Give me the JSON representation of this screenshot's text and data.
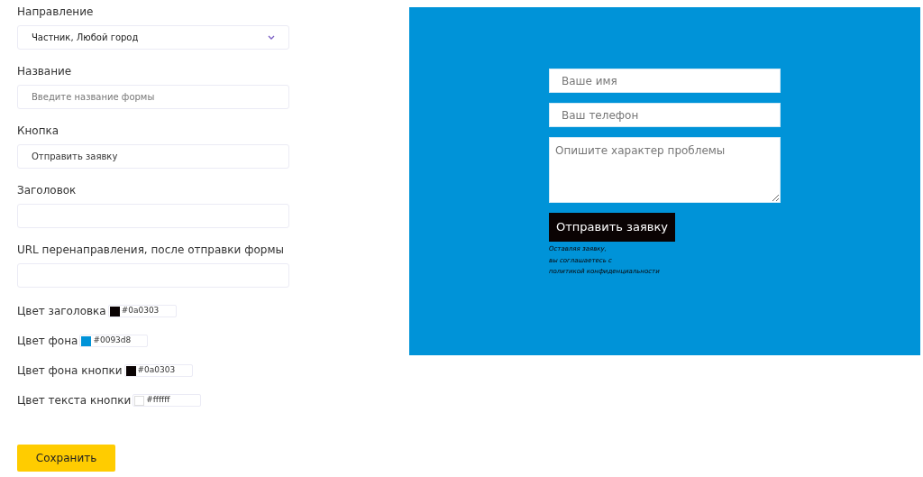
{
  "settings": {
    "direction": {
      "label": "Направление",
      "value": "Частник, Любой город"
    },
    "fields": [
      {
        "label": "Название",
        "placeholder": "Введите название формы"
      },
      {
        "label": "Кнопка",
        "value": "Отправить заявку"
      },
      {
        "label": "Заголовок"
      },
      {
        "label": "URL перенаправления, после отправки формы"
      }
    ],
    "colors": [
      {
        "label": "Цвет заголовка",
        "value": "#0a0303",
        "color": "#0a0303"
      },
      {
        "label": "Цвет фона",
        "value": "#0093d8",
        "color": "#0093d8"
      },
      {
        "label": "Цвет фона кнопки",
        "value": "#0a0303",
        "color": "#0a0303"
      },
      {
        "label": "Цвет текста кнопки",
        "value": "#ffffff",
        "color": "#ffffff"
      }
    ],
    "save_button": "Сохранить"
  },
  "preview": {
    "name_placeholder": "Ваше имя",
    "phone_placeholder": "Ваш телефон",
    "problem_placeholder": "Опишите характер проблемы",
    "submit": "Отправить заявку",
    "consent_lines": [
      "Оставляя заявку,",
      "вы соглашаетесь с",
      "политикой конфиденциальности"
    ]
  }
}
